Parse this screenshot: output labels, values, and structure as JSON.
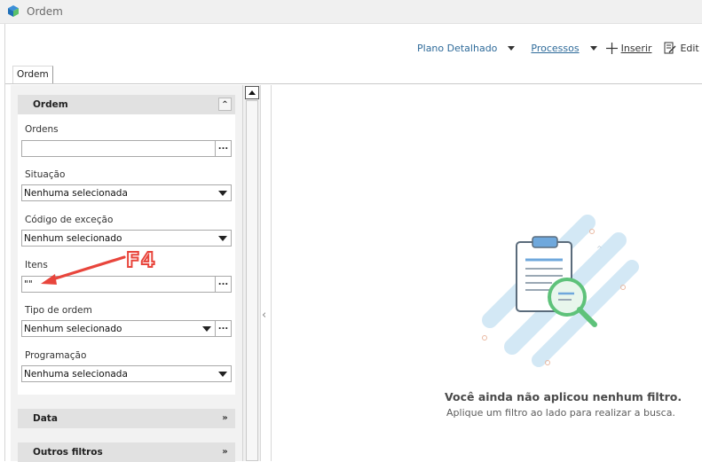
{
  "window": {
    "title": "Ordem"
  },
  "toolbar": {
    "plano_label": "Plano Detalhado",
    "processos_label": "Processos",
    "inserir_label": "Inserir",
    "editar_label": "Edit"
  },
  "tab": {
    "label": "Ordem"
  },
  "filters": {
    "section_title": "Ordem",
    "fields": {
      "ordens": {
        "label": "Ordens",
        "value": ""
      },
      "situacao": {
        "label": "Situação",
        "value": "Nenhuma selecionada"
      },
      "codigo_excecao": {
        "label": "Código de exceção",
        "value": "Nenhum selecionado"
      },
      "itens": {
        "label": "Itens",
        "value": "\"\""
      },
      "tipo_ordem": {
        "label": "Tipo de ordem",
        "value": "Nenhum selecionado"
      },
      "programacao": {
        "label": "Programação",
        "value": "Nenhuma selecionada"
      }
    },
    "sections": {
      "data": "Data",
      "outros": "Outros filtros"
    }
  },
  "annotation": {
    "label": "F4",
    "color": "#e8453c"
  },
  "empty_state": {
    "title": "Você ainda não aplicou nenhum filtro.",
    "subtitle": "Aplique um filtro ao lado para realizar a busca."
  },
  "colors": {
    "link": "#2f6b9a",
    "illustration_accent": "#5ec27a",
    "illustration_blue": "#cfe6f5"
  }
}
